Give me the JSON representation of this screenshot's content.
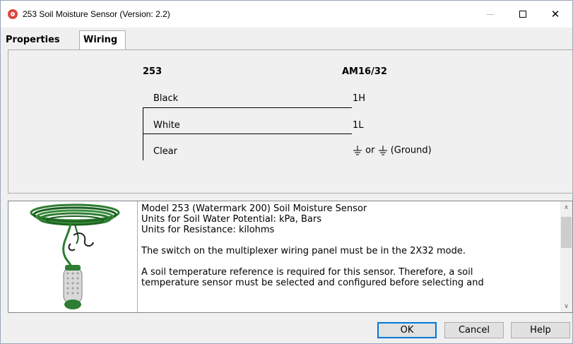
{
  "window": {
    "title": "253 Soil Moisture Sensor (Version: 2.2)",
    "icon": "app-icon",
    "controls": {
      "minimize": "minimize-icon",
      "maximize": "maximize-icon",
      "close": "close-icon"
    }
  },
  "tabs": [
    {
      "label": "Properties",
      "selected": false
    },
    {
      "label": "Wiring",
      "selected": true
    }
  ],
  "wiring": {
    "left_header": "253",
    "right_header": "AM16/32",
    "rows": [
      {
        "wire": "Black",
        "terminal": "1H"
      },
      {
        "wire": "White",
        "terminal": "1L"
      },
      {
        "wire": "Clear",
        "terminal_or": "or",
        "terminal_ground": "(Ground)",
        "icons": [
          "ground-icon",
          "ground-icon"
        ]
      }
    ]
  },
  "info": {
    "image": "soil-moisture-sensor-image",
    "lines": [
      "Model 253 (Watermark 200) Soil Moisture Sensor",
      "Units for Soil Water Potential: kPa, Bars",
      "Units for Resistance: kilohms",
      "",
      "The switch on the multiplexer wiring panel must be in the 2X32 mode.",
      "",
      "A soil temperature reference is required for this sensor. Therefore, a soil",
      "temperature sensor must be selected and configured before selecting and"
    ],
    "scrollbar": {
      "up": "chevron-up-icon",
      "down": "chevron-down-icon"
    }
  },
  "buttons": {
    "ok": "OK",
    "cancel": "Cancel",
    "help": "Help"
  },
  "colors": {
    "accent": "#0078d7",
    "app_icon": "#e0463b",
    "sensor_green": "#2e7d32"
  }
}
